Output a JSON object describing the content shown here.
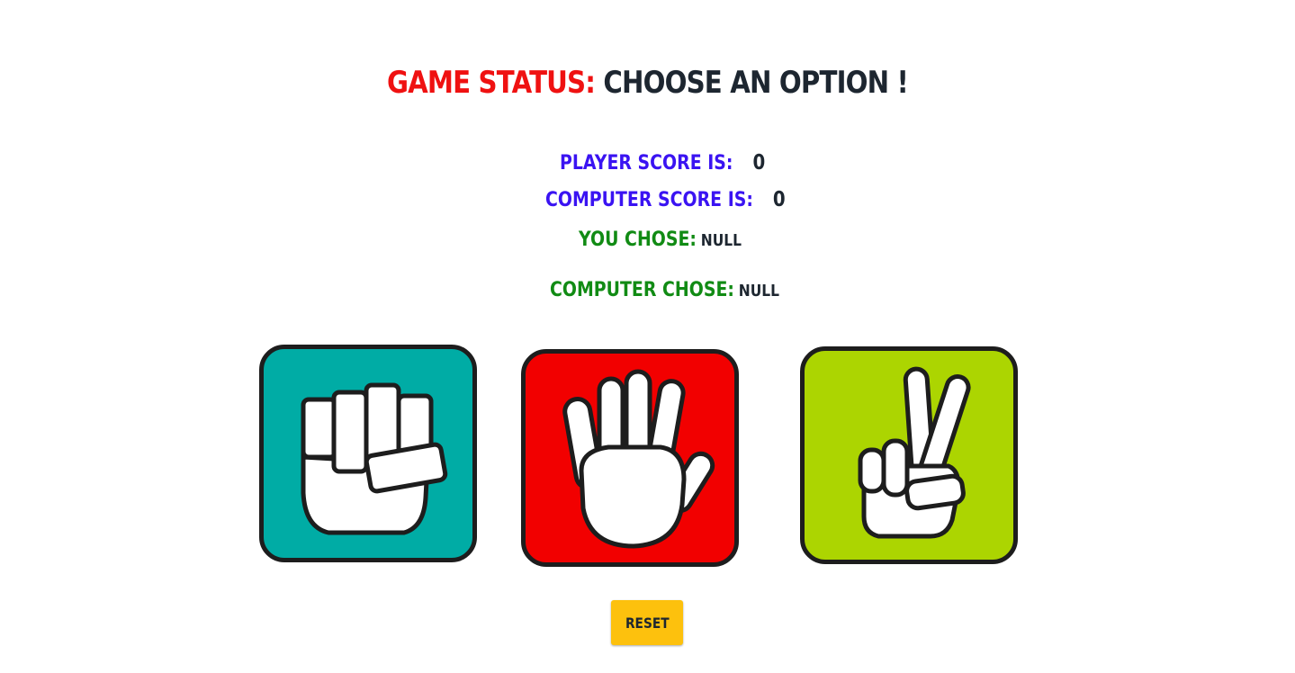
{
  "status": {
    "label": "Game Status:",
    "value": "Choose an option !"
  },
  "scores": {
    "player_label": "Player score is:",
    "player_value": "0",
    "computer_label": "Computer score is:",
    "computer_value": "0"
  },
  "choices_made": {
    "you_label": "You chose:",
    "you_value": "null",
    "computer_label": "Computer chose:",
    "computer_value": "null"
  },
  "options": [
    {
      "icon": "rock-fist-icon",
      "color": "#00aca5"
    },
    {
      "icon": "paper-hand-icon",
      "color": "#f20000"
    },
    {
      "icon": "scissors-peace-icon",
      "color": "#acd501"
    }
  ],
  "reset_label": "Reset"
}
